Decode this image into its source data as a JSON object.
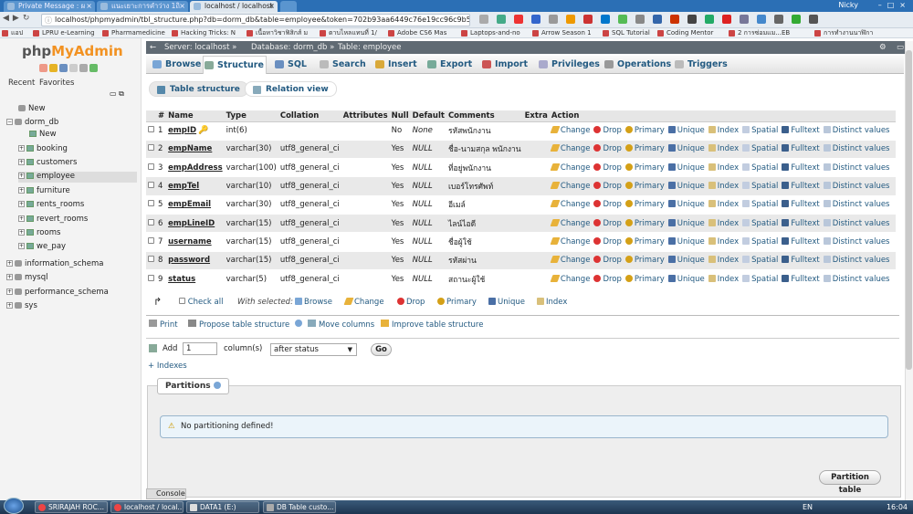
{
  "browser": {
    "tabs": [
      {
        "label": "Private Message : ผ"
      },
      {
        "label": "แนะเยาะการคำว่าง 1ถิ"
      },
      {
        "label": "localhost / localhost"
      }
    ],
    "user": "Nicky",
    "url": "localhost/phpmyadmin/tbl_structure.php?db=dorm_db&table=employee&token=702b93aa6449c76e19cc96c9b5",
    "bookmarks": [
      "แอป",
      "LPRU e-Learning",
      "Pharmamedicine",
      "Hacking Tricks: N",
      "เนื้อหาวิชาฟิสิกส์ ม",
      "ตาบไหลแทนที่ 1/",
      "Adobe CS6 Mas",
      "Laptops-and-no",
      "Arrow Season 1",
      "SQL Tutorial",
      "Coding Mentor",
      "2 การซ่อมแม...EB",
      "การทำงานนาฬิกา"
    ]
  },
  "sidebar": {
    "logo_php": "php",
    "logo_myadmin": "MyAdmin",
    "recent": "Recent",
    "favorites": "Favorites",
    "tree": {
      "new_root": "New",
      "dorm_db": "dorm_db",
      "new_table": "New",
      "tables": [
        "booking",
        "customers",
        "employee",
        "furniture",
        "rents_rooms",
        "revert_rooms",
        "rooms",
        "we_pay"
      ],
      "other_dbs": [
        "information_schema",
        "mysql",
        "performance_schema",
        "sys"
      ]
    }
  },
  "header": {
    "server": "Server: localhost »",
    "database": "Database: dorm_db »",
    "table": "Table: employee"
  },
  "topmenu": [
    "Browse",
    "Structure",
    "SQL",
    "Search",
    "Insert",
    "Export",
    "Import",
    "Privileges",
    "Operations",
    "Triggers"
  ],
  "subtabs": [
    "Table structure",
    "Relation view"
  ],
  "columns_header": [
    "#",
    "Name",
    "Type",
    "Collation",
    "Attributes",
    "Null",
    "Default",
    "Comments",
    "Extra",
    "Action"
  ],
  "rows": [
    {
      "n": "1",
      "name": "empID",
      "type": "int(6)",
      "collation": "",
      "null": "No",
      "default": "None",
      "comment": "รหัสพนักงาน",
      "primary": true
    },
    {
      "n": "2",
      "name": "empName",
      "type": "varchar(30)",
      "collation": "utf8_general_ci",
      "null": "Yes",
      "default": "NULL",
      "comment": "ชื่อ-นามสกุล พนักงาน"
    },
    {
      "n": "3",
      "name": "empAddress",
      "type": "varchar(100)",
      "collation": "utf8_general_ci",
      "null": "Yes",
      "default": "NULL",
      "comment": "ที่อยู่พนักงาน"
    },
    {
      "n": "4",
      "name": "empTel",
      "type": "varchar(10)",
      "collation": "utf8_general_ci",
      "null": "Yes",
      "default": "NULL",
      "comment": "เบอร์โทรศัพท์"
    },
    {
      "n": "5",
      "name": "empEmail",
      "type": "varchar(30)",
      "collation": "utf8_general_ci",
      "null": "Yes",
      "default": "NULL",
      "comment": "อีเมล์"
    },
    {
      "n": "6",
      "name": "empLineID",
      "type": "varchar(15)",
      "collation": "utf8_general_ci",
      "null": "Yes",
      "default": "NULL",
      "comment": "ไลน์ไอดี"
    },
    {
      "n": "7",
      "name": "username",
      "type": "varchar(15)",
      "collation": "utf8_general_ci",
      "null": "Yes",
      "default": "NULL",
      "comment": "ชื่อผู้ใช้"
    },
    {
      "n": "8",
      "name": "password",
      "type": "varchar(15)",
      "collation": "utf8_general_ci",
      "null": "Yes",
      "default": "NULL",
      "comment": "รหัสผ่าน"
    },
    {
      "n": "9",
      "name": "status",
      "type": "varchar(5)",
      "collation": "utf8_general_ci",
      "null": "Yes",
      "default": "NULL",
      "comment": "สถานะผู้ใช้"
    }
  ],
  "actions": [
    "Change",
    "Drop",
    "Primary",
    "Unique",
    "Index",
    "Spatial",
    "Fulltext",
    "Distinct values"
  ],
  "checkall": {
    "check_all": "Check all",
    "with_selected": "With selected:",
    "browse": "Browse",
    "change": "Change",
    "drop": "Drop",
    "primary": "Primary",
    "unique": "Unique",
    "index": "Index"
  },
  "tools": {
    "print": "Print",
    "propose": "Propose table structure",
    "move": "Move columns",
    "improve": "Improve table structure"
  },
  "addcol": {
    "add": "Add",
    "count": "1",
    "columns": "column(s)",
    "position": "after status",
    "go": "Go"
  },
  "indexes": "+ Indexes",
  "partitions": {
    "legend": "Partitions",
    "message": "No partitioning defined!",
    "button": "Partition table"
  },
  "console": "Console",
  "taskbar": {
    "items": [
      "SRIRAJAH ROC...",
      "localhost / local...",
      "DATA1 (E:)",
      "DB Table custo..."
    ],
    "lang": "EN",
    "time": "16:04"
  }
}
